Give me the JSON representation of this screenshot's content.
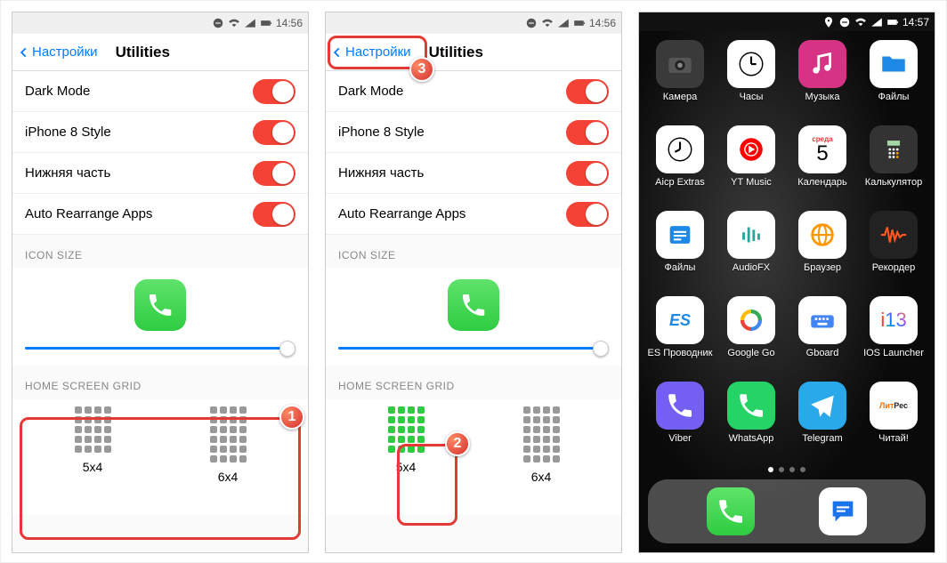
{
  "time1": "14:56",
  "time2": "14:56",
  "time3": "14:57",
  "back_label": "Настройки",
  "title": "Utilities",
  "toggles": [
    {
      "label": "Dark Mode"
    },
    {
      "label": "iPhone 8 Style"
    },
    {
      "label": "Нижняя часть"
    },
    {
      "label": "Auto Rearrange Apps"
    }
  ],
  "section_icon": "ICON SIZE",
  "section_grid": "HOME SCREEN GRID",
  "grid_5x4": "5x4",
  "grid_6x4": "6x4",
  "badge1": "1",
  "badge2": "2",
  "badge3": "3",
  "apps": [
    {
      "label": "Камера",
      "bg": "#3a3a3a",
      "fg": "#eee",
      "glyph": "camera"
    },
    {
      "label": "Часы",
      "bg": "#fff",
      "fg": "#000",
      "glyph": "clock"
    },
    {
      "label": "Музыка",
      "bg": "#d63384",
      "fg": "#fff",
      "glyph": "music"
    },
    {
      "label": "Файлы",
      "bg": "#fff",
      "fg": "#1e88e5",
      "glyph": "folder"
    },
    {
      "label": "Aicp Extras",
      "bg": "#fff",
      "fg": "#000",
      "glyph": "clock2"
    },
    {
      "label": "YT Music",
      "bg": "#fff",
      "fg": "#ff0000",
      "glyph": "ytmusic"
    },
    {
      "label": "Календарь",
      "bg": "#fff",
      "fg": "#000",
      "glyph": "calendar",
      "extra": "среда",
      "day": "5"
    },
    {
      "label": "Калькулятор",
      "bg": "#333",
      "fg": "#fff",
      "glyph": "calc"
    },
    {
      "label": "Файлы",
      "bg": "#fff",
      "fg": "#1e88e5",
      "glyph": "files2"
    },
    {
      "label": "AudioFX",
      "bg": "#fff",
      "fg": "#26a69a",
      "glyph": "eq"
    },
    {
      "label": "Браузер",
      "bg": "#fff",
      "fg": "#ff9800",
      "glyph": "globe"
    },
    {
      "label": "Рекордер",
      "bg": "#222",
      "fg": "#ff5722",
      "glyph": "wave"
    },
    {
      "label": "ES Проводник",
      "bg": "#fff",
      "fg": "#1e88e5",
      "glyph": "es"
    },
    {
      "label": "Google Go",
      "bg": "#fff",
      "fg": "#4285f4",
      "glyph": "google"
    },
    {
      "label": "Gboard",
      "bg": "#fff",
      "fg": "#4285f4",
      "glyph": "gboard"
    },
    {
      "label": "IOS Launcher",
      "bg": "#fff",
      "fg": "#ff3b30",
      "glyph": "i13"
    },
    {
      "label": "Viber",
      "bg": "#7360f2",
      "fg": "#fff",
      "glyph": "viber"
    },
    {
      "label": "WhatsApp",
      "bg": "#25d366",
      "fg": "#fff",
      "glyph": "whatsapp"
    },
    {
      "label": "Telegram",
      "bg": "#29a9ea",
      "fg": "#fff",
      "glyph": "telegram"
    },
    {
      "label": "Читай!",
      "bg": "#fff",
      "fg": "#ff6f00",
      "glyph": "litres"
    }
  ],
  "dock": [
    {
      "bg": "linear-gradient(#5fe36b,#2ecc40)",
      "fg": "#fff",
      "glyph": "phone"
    },
    {
      "bg": "#fff",
      "fg": "#1a73e8",
      "glyph": "messages"
    }
  ]
}
